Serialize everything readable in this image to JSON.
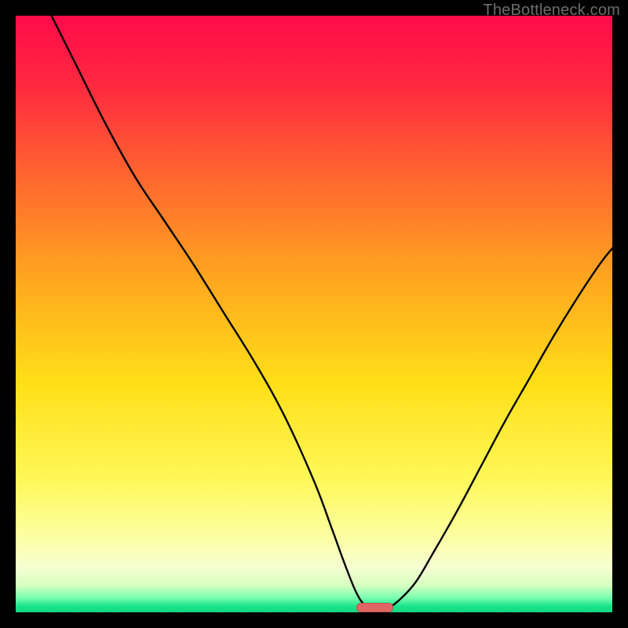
{
  "watermark": "TheBottleneck.com",
  "colors": {
    "frame": "#000000",
    "curve": "#000000",
    "bar_fill": "#e06666",
    "bar_stroke": "#c44e4e",
    "gradient_stops": [
      {
        "offset": 0.0,
        "color": "#ff0b4a"
      },
      {
        "offset": 0.12,
        "color": "#ff2a3f"
      },
      {
        "offset": 0.28,
        "color": "#ff6a2e"
      },
      {
        "offset": 0.45,
        "color": "#ffaa1e"
      },
      {
        "offset": 0.62,
        "color": "#ffe018"
      },
      {
        "offset": 0.78,
        "color": "#fff85a"
      },
      {
        "offset": 0.87,
        "color": "#fcff9f"
      },
      {
        "offset": 0.925,
        "color": "#f6ffd2"
      },
      {
        "offset": 0.955,
        "color": "#d6ffc0"
      },
      {
        "offset": 0.975,
        "color": "#7cffb0"
      },
      {
        "offset": 0.99,
        "color": "#18e48a"
      },
      {
        "offset": 1.0,
        "color": "#15d883"
      }
    ]
  },
  "chart_data": {
    "type": "line",
    "title": "",
    "xlabel": "",
    "ylabel": "",
    "xlim": [
      0,
      100
    ],
    "ylim": [
      0,
      100
    ],
    "series": [
      {
        "name": "bottleneck-curve",
        "x": [
          6,
          10,
          15,
          20,
          25,
          30,
          35,
          40,
          45,
          50,
          53,
          55,
          57,
          58.5,
          60,
          62,
          64,
          67,
          70,
          74,
          78,
          82,
          86,
          90,
          94,
          98,
          100
        ],
        "y": [
          100,
          92,
          82,
          73,
          65.5,
          58,
          50,
          42,
          33,
          22,
          14,
          8.5,
          3.5,
          1.2,
          0.6,
          0.6,
          1.8,
          5,
          10,
          17,
          24.5,
          32,
          39,
          46,
          52.5,
          58.5,
          61
        ]
      }
    ],
    "marker": {
      "name": "optimal-range-bar",
      "x_center": 60.2,
      "y": 0.8,
      "width": 6.2,
      "height": 1.6,
      "color": "#e06666"
    }
  }
}
